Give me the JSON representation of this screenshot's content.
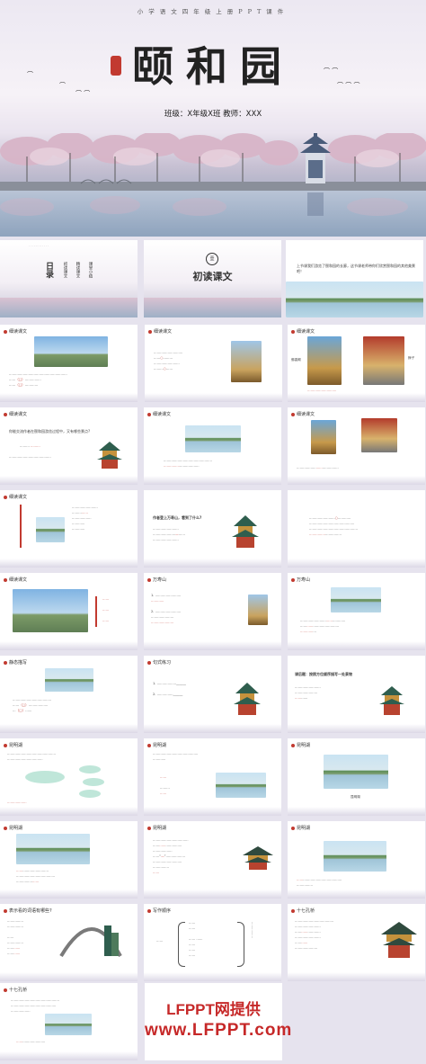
{
  "hero": {
    "top_text": "小学语文四年级上册PPT课件",
    "title": "颐和园",
    "subtitle": "班级：X年级X班   教师：XXX"
  },
  "tiles": {
    "t2_vertical": [
      "日录",
      "初读课文",
      "精读课文",
      "课堂小结"
    ],
    "t3_title": "初读课文",
    "t4_text": "上节课我们游览了颐和园的长廊，这节课老师带你们欣赏颐和园的其他美景吧！",
    "sec_read": "细读课文",
    "sec_wanshoushan": "万寿山",
    "sec_static": "静态描写",
    "sec_sentence": "句式练习",
    "sec_kunming": "昆明湖",
    "sec_writing": "写作顺序",
    "sec_bridge": "十七孔桥",
    "q_bridges": "表示看的词语有哪些?",
    "q_order": "作者登上万寿山，看到了什么?",
    "q_wayfinding": "你能交流作者在颐和园游览过程中，又有哪些景点?",
    "q_sentence": "课后题：按照方位顺序描写一处景物",
    "label_foxiangge": "佛香阁",
    "label_paiyun": "排云殿",
    "label_shiqikong": "十七孔桥",
    "label_changlang": "长廊",
    "label_wanshoushan": "万寿山",
    "label_kunming": "昆明湖",
    "label_shizi": "狮子"
  },
  "brand": {
    "line1": "LFPPT网提供",
    "line2": "www.LFPPT.com"
  },
  "colors": {
    "accent": "#c23a30",
    "brand": "#c62828"
  }
}
